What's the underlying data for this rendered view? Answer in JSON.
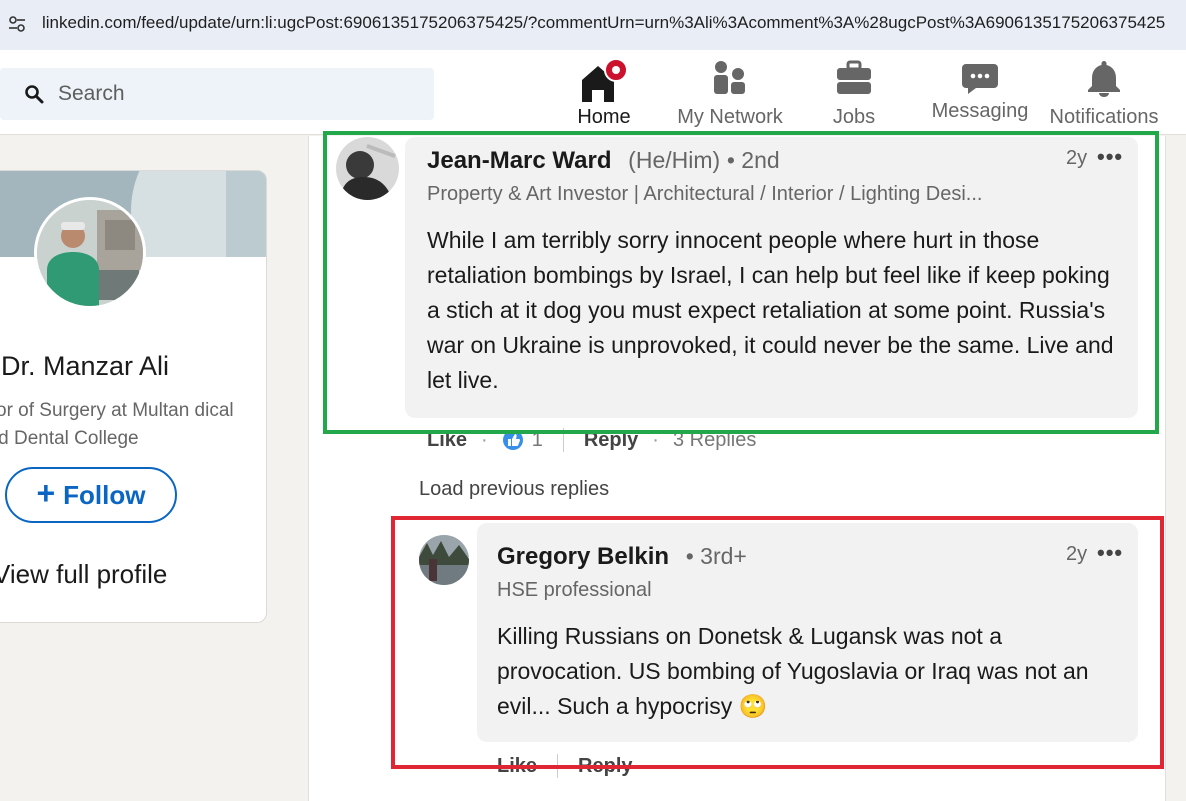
{
  "browser": {
    "url": "linkedin.com/feed/update/urn:li:ugcPost:6906135175206375425/?commentUrn=urn%3Ali%3Acomment%3A%28ugcPost%3A6906135175206375425"
  },
  "nav": {
    "search_placeholder": "Search",
    "items": [
      {
        "label": "Home",
        "icon": "home-icon",
        "active": true,
        "badge": true
      },
      {
        "label": "My Network",
        "icon": "network-icon"
      },
      {
        "label": "Jobs",
        "icon": "briefcase-icon"
      },
      {
        "label": "Messaging",
        "icon": "chat-icon"
      },
      {
        "label": "Notifications",
        "icon": "bell-icon"
      }
    ]
  },
  "profile": {
    "name": "Dr. Manzar Ali",
    "headline": "ssor of Surgery at Multan dical and Dental College",
    "follow_label": "Follow",
    "view_profile": "View full profile"
  },
  "comments": [
    {
      "name": "Jean-Marc Ward",
      "pronouns": "(He/Him)",
      "degree": "• 2nd",
      "headline": "Property & Art Investor | Architectural / Interior / Lighting Desi...",
      "time": "2y",
      "text": "While I am terribly sorry innocent people where hurt in those retaliation bombings by Israel, I can help but feel like if keep poking a stich at it dog you must expect retaliation at some point. Russia's war on Ukraine is unprovoked, it could never be the same. Live and let live.",
      "like_label": "Like",
      "reaction_count": "1",
      "reply_label": "Reply",
      "replies_label": "3 Replies"
    },
    {
      "name": "Gregory Belkin",
      "degree": "• 3rd+",
      "headline": "HSE professional",
      "time": "2y",
      "text": "Killing Russians on Donetsk & Lugansk was not a provocation. US bombing of Yugoslavia or Iraq was not an evil... Such a hypocrisy 🙄",
      "like_label": "Like",
      "reply_label": "Reply"
    }
  ],
  "load_previous": "Load previous replies",
  "annotations": {
    "green": "#22a84a",
    "red": "#e02533"
  }
}
